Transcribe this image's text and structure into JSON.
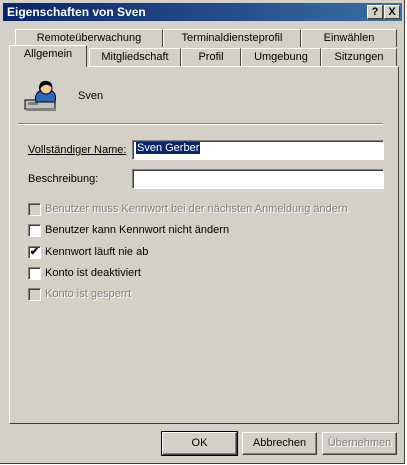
{
  "window": {
    "title": "Eigenschaften von Sven",
    "help_glyph": "?",
    "close_glyph": "X"
  },
  "tabs": {
    "row_back": [
      "Remoteüberwachung",
      "Terminaldiensteprofil",
      "Einwählen"
    ],
    "row_front": [
      "Allgemein",
      "Mitgliedschaft",
      "Profil",
      "Umgebung",
      "Sitzungen"
    ],
    "active": "Allgemein"
  },
  "general": {
    "user_name": "Sven",
    "full_name_label": "Vollständiger Name:",
    "full_name_value": "Sven Gerber",
    "description_label": "Beschreibung:",
    "description_value": ""
  },
  "options": [
    {
      "label": "Benutzer muss Kennwort bei der nächsten Anmeldung ändern",
      "checked": false,
      "enabled": false
    },
    {
      "label": "Benutzer kann Kennwort nicht ändern",
      "checked": false,
      "enabled": true
    },
    {
      "label": "Kennwort läuft nie ab",
      "checked": true,
      "enabled": true
    },
    {
      "label": "Konto ist deaktiviert",
      "checked": false,
      "enabled": true
    },
    {
      "label": "Konto ist gesperrt",
      "checked": false,
      "enabled": false
    }
  ],
  "buttons": {
    "ok": "OK",
    "cancel": "Abbrechen",
    "apply": "Übernehmen"
  },
  "check_glyph": "✔"
}
